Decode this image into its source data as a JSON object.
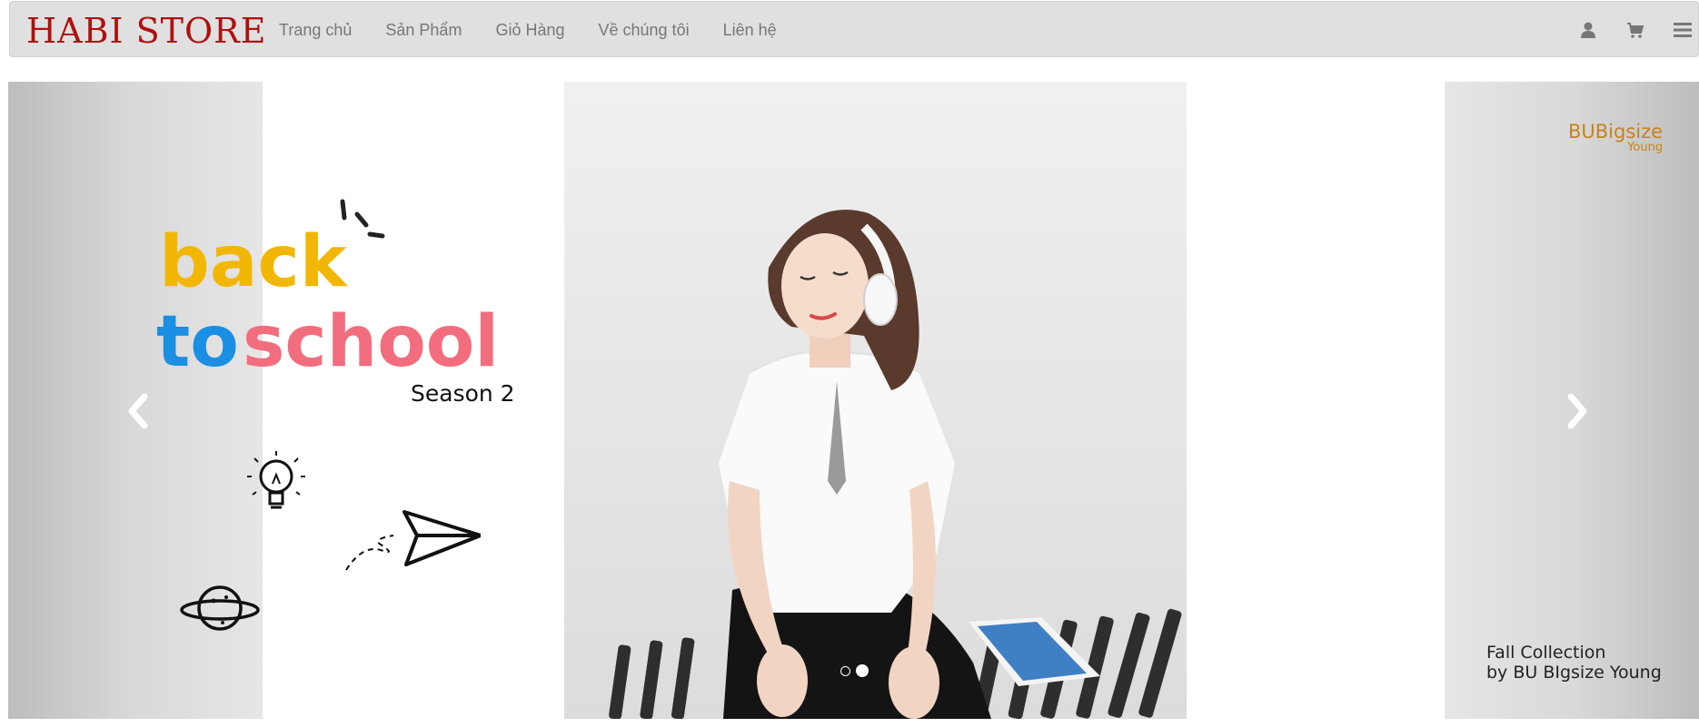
{
  "brand": {
    "name": "HABI STORE"
  },
  "nav": {
    "links": [
      {
        "label": "Trang chủ"
      },
      {
        "label": "Sản Phẩm"
      },
      {
        "label": "Giỏ Hàng"
      },
      {
        "label": "Về chúng tôi"
      },
      {
        "label": "Liên hệ"
      }
    ],
    "icons": [
      "user-icon",
      "cart-icon",
      "menu-icon"
    ]
  },
  "carousel": {
    "slide": {
      "headline_word1": "back",
      "headline_word2": "to",
      "headline_word3": "school",
      "season": "Season 2",
      "logo_line1": "BUBigsize",
      "logo_line2": "Young",
      "collection_line1": "Fall Collection",
      "collection_line2": "by BU BIgsize Young"
    },
    "indicators": {
      "count": 2,
      "active_index": 1
    },
    "controls": [
      "chevron-left-icon",
      "chevron-right-icon"
    ]
  },
  "colors": {
    "brand": "#b01010",
    "navbar_bg": "#e0e0e0",
    "nav_link": "#777777",
    "headline_yellow": "#f2b705",
    "headline_blue": "#1a8fe3",
    "headline_pink": "#f26d7d",
    "logo_orange": "#c8821a"
  }
}
